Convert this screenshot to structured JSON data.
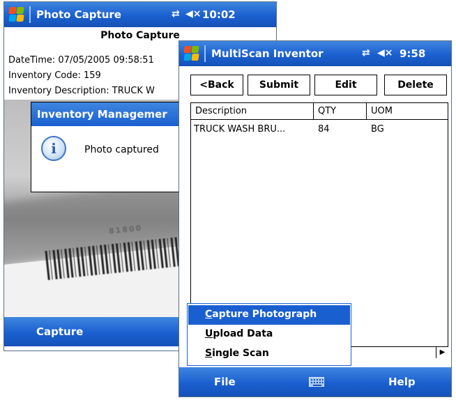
{
  "back_window": {
    "titlebar": {
      "title": "Photo Capture",
      "connectivity_icon": "connectivity-icon",
      "volume_icon": "volume-muted-icon",
      "clock": "10:02"
    },
    "heading": "Photo Capture",
    "datetime_line": "DateTime: 07/05/2005 09:58:51",
    "inventory_code_line": "Inventory Code: 159",
    "inventory_description_line": "Inventory Description: TRUCK W",
    "camera_digits": "81800",
    "dialog": {
      "title": "Inventory Managemer",
      "message": "Photo captured",
      "icon": "info-icon"
    },
    "menubar": {
      "capture_label": "Capture"
    }
  },
  "front_window": {
    "titlebar": {
      "title": "MultiScan Inventor",
      "connectivity_icon": "connectivity-icon",
      "volume_icon": "volume-muted-icon",
      "clock": "9:58"
    },
    "toolbar": {
      "back_label": "<Back",
      "submit_label": "Submit",
      "edit_label": "Edit",
      "delete_label": "Delete"
    },
    "table": {
      "columns": [
        "Description",
        "QTY",
        "UOM"
      ],
      "rows": [
        {
          "description": "TRUCK WASH BRU...",
          "qty": "84",
          "uom": "BG"
        }
      ]
    },
    "popup_menu": {
      "items": [
        {
          "label": "Capture Photograph",
          "hotkey": "C",
          "rest": "apture Photograph",
          "selected": true
        },
        {
          "label": "Upload Data",
          "hotkey": "U",
          "rest": "pload Data",
          "selected": false
        },
        {
          "label": "Single Scan",
          "hotkey": "S",
          "rest": "ingle Scan",
          "selected": false
        }
      ]
    },
    "menubar": {
      "file_label": "File",
      "keyboard_icon": "keyboard-icon",
      "help_label": "Help"
    },
    "scroll_arrow": "▶"
  },
  "colors": {
    "titlebar_blue": "#1a5fcf",
    "menu_selection": "#1a5fcf"
  }
}
